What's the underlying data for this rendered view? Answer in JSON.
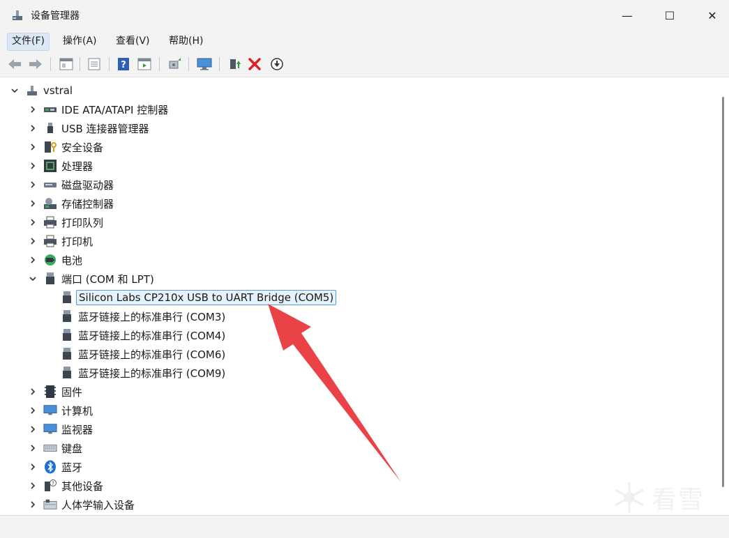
{
  "window": {
    "title": "设备管理器",
    "controls": {
      "minimize": "—",
      "maximize": "☐",
      "close": "✕"
    }
  },
  "menu": [
    {
      "label": "文件(F)",
      "active": true
    },
    {
      "label": "操作(A)"
    },
    {
      "label": "查看(V)"
    },
    {
      "label": "帮助(H)"
    }
  ],
  "toolbar": {
    "buttons": [
      "back-icon",
      "forward-icon",
      "properties-icon",
      "update-icon",
      "help-icon",
      "view-icon",
      "scan-icon",
      "monitor-icon",
      "enable-icon",
      "uninstall-icon",
      "download-icon"
    ]
  },
  "tree": {
    "root": {
      "label": "vstral",
      "icon": "computer-icon",
      "expanded": true
    },
    "categories": [
      {
        "label": "IDE ATA/ATAPI 控制器",
        "icon": "ide-controller-icon"
      },
      {
        "label": "USB 连接器管理器",
        "icon": "usb-icon"
      },
      {
        "label": "安全设备",
        "icon": "security-device-icon"
      },
      {
        "label": "处理器",
        "icon": "processor-icon"
      },
      {
        "label": "磁盘驱动器",
        "icon": "disk-drive-icon"
      },
      {
        "label": "存储控制器",
        "icon": "storage-controller-icon"
      },
      {
        "label": "打印队列",
        "icon": "printer-queue-icon"
      },
      {
        "label": "打印机",
        "icon": "printer-icon"
      },
      {
        "label": "电池",
        "icon": "battery-icon"
      },
      {
        "label": "端口 (COM 和 LPT)",
        "icon": "port-icon",
        "expanded": true
      },
      {
        "label": "固件",
        "icon": "firmware-icon"
      },
      {
        "label": "计算机",
        "icon": "computer-monitor-icon"
      },
      {
        "label": "监视器",
        "icon": "monitor-icon"
      },
      {
        "label": "键盘",
        "icon": "keyboard-icon"
      },
      {
        "label": "蓝牙",
        "icon": "bluetooth-icon"
      },
      {
        "label": "其他设备",
        "icon": "other-device-icon"
      },
      {
        "label": "人体学输入设备",
        "icon": "hid-icon"
      }
    ],
    "ports_children": [
      {
        "label": "Silicon Labs CP210x USB to UART Bridge (COM5)",
        "selected": true
      },
      {
        "label": "蓝牙链接上的标准串行 (COM3)"
      },
      {
        "label": "蓝牙链接上的标准串行 (COM4)"
      },
      {
        "label": "蓝牙链接上的标准串行 (COM6)"
      },
      {
        "label": "蓝牙链接上的标准串行 (COM9)"
      }
    ]
  },
  "watermark": {
    "text": "看雪"
  },
  "colors": {
    "arrow": "#e8383d",
    "selection_border": "#5b9bd5",
    "selection_fill": "#e5f1fb"
  }
}
